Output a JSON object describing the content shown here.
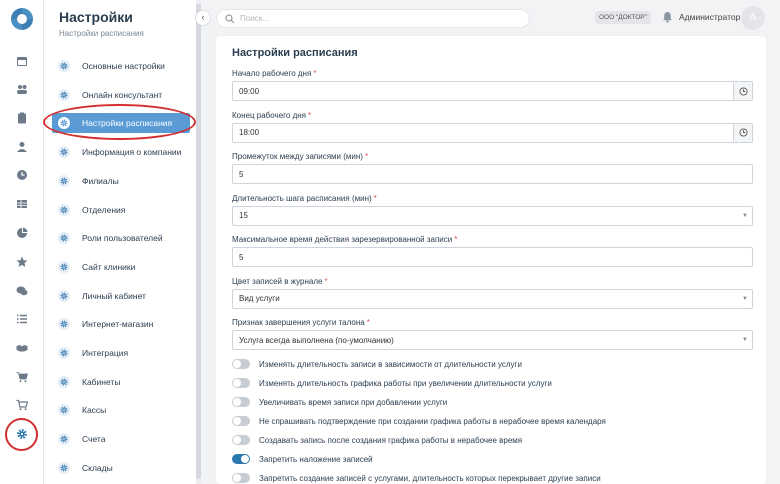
{
  "app": {
    "title": "Настройки",
    "subtitle": "Настройки расписания"
  },
  "rail": {
    "icons": [
      "calendar-icon",
      "users-icon",
      "clipboard-icon",
      "user-icon",
      "clock-icon",
      "table-icon",
      "pie-chart-icon",
      "star-icon",
      "chat-icon",
      "list-icon",
      "handshake-icon",
      "cart-icon",
      "cart-alt-icon",
      "gear-icon"
    ],
    "active": "gear-icon"
  },
  "sidebar": {
    "items": [
      {
        "label": "Основные настройки"
      },
      {
        "label": "Онлайн консультант"
      },
      {
        "label": "Настройки расписания",
        "active": true
      },
      {
        "label": "Информация о компании"
      },
      {
        "label": "Филиалы"
      },
      {
        "label": "Отделения"
      },
      {
        "label": "Роли пользователей"
      },
      {
        "label": "Сайт клиники"
      },
      {
        "label": "Личный кабинет"
      },
      {
        "label": "Интернет-магазин"
      },
      {
        "label": "Интеграция"
      },
      {
        "label": "Кабинеты"
      },
      {
        "label": "Кассы"
      },
      {
        "label": "Счета"
      },
      {
        "label": "Склады"
      }
    ]
  },
  "header": {
    "search_placeholder": "Поиск...",
    "org_badge": "ООО \"ДОКТОР\"",
    "user_name": "Администратор",
    "avatar_letter": "А"
  },
  "form": {
    "title": "Настройки расписания",
    "required_mark": "*",
    "fields": [
      {
        "label": "Начало рабочего дня",
        "value": "09:00",
        "kind": "time"
      },
      {
        "label": "Конец рабочего дня",
        "value": "18:00",
        "kind": "time"
      },
      {
        "label": "Промежуток между записями (мин)",
        "value": "5",
        "kind": "text"
      },
      {
        "label": "Длительность шага расписания (мин)",
        "value": "15",
        "kind": "select"
      },
      {
        "label": "Максимальное время действия зарезервированной записи",
        "value": "5",
        "kind": "text"
      },
      {
        "label": "Цвет записей в журнале",
        "value": "Вид услуги",
        "kind": "select"
      },
      {
        "label": "Признак завершения услуги талона",
        "value": "Услуга всегда выполнена (по-умолчанию)",
        "kind": "select"
      }
    ],
    "toggles": [
      {
        "label": "Изменять длительность записи в зависимости от длительности услуги",
        "on": false
      },
      {
        "label": "Изменять длительность графика работы при увеличении длительности услуги",
        "on": false
      },
      {
        "label": "Увеличивать время записи при добавлении услуги",
        "on": false
      },
      {
        "label": "Не спрашивать подтверждение при создании графика работы в нерабочее время календаря",
        "on": false
      },
      {
        "label": "Создавать запись после создания графика работы в нерабочее время",
        "on": false
      },
      {
        "label": "Запретить наложение записей",
        "on": true
      },
      {
        "label": "Запретить создание записей с услугами, длительность которых перекрывает другие записи",
        "on": false
      }
    ]
  },
  "colors": {
    "accent": "#2a7ab0",
    "active_item": "#5a9bd5",
    "highlight": "#d32f2f"
  }
}
